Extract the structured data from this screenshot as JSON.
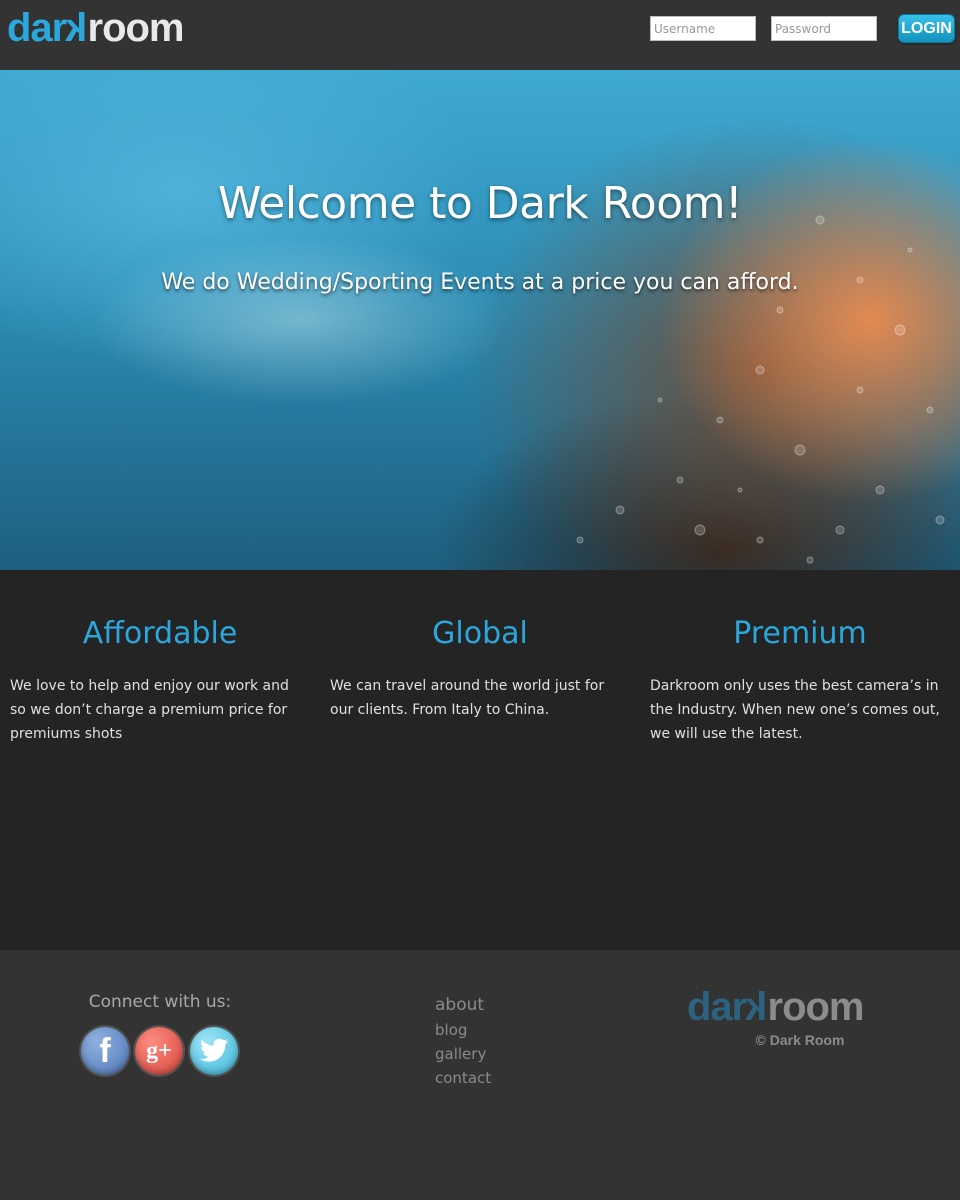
{
  "header": {
    "logo": {
      "part1": "dar",
      "part2": "k",
      "part3": "room"
    },
    "username_placeholder": "Username",
    "password_placeholder": "Password",
    "login_label": "LOGIN"
  },
  "hero": {
    "title": "Welcome to Dark Room!",
    "subtitle": "We do Wedding/Sporting Events at a price you can afford."
  },
  "features": [
    {
      "title": "Affordable",
      "text": "We love to help and enjoy our work and so we don’t charge a premium price for premiums shots"
    },
    {
      "title": "Global",
      "text": "We can travel around the world just for our clients. From Italy to China."
    },
    {
      "title": "Premium",
      "text": "Darkroom only uses the best camera’s in the Industry. When new one’s comes out, we will use the latest."
    }
  ],
  "footer": {
    "connect_label": "Connect with us:",
    "social": {
      "facebook": "f",
      "googleplus": "g+",
      "twitter_icon": "twitter-bird-icon"
    },
    "links": [
      "about",
      "blog",
      "gallery",
      "contact"
    ],
    "logo": {
      "part1": "dar",
      "part2": "k",
      "part3": "room"
    },
    "copyright": "© Dark Room"
  },
  "colors": {
    "accent": "#2aa7dc",
    "header_bg": "#333333",
    "features_bg": "#242424"
  }
}
